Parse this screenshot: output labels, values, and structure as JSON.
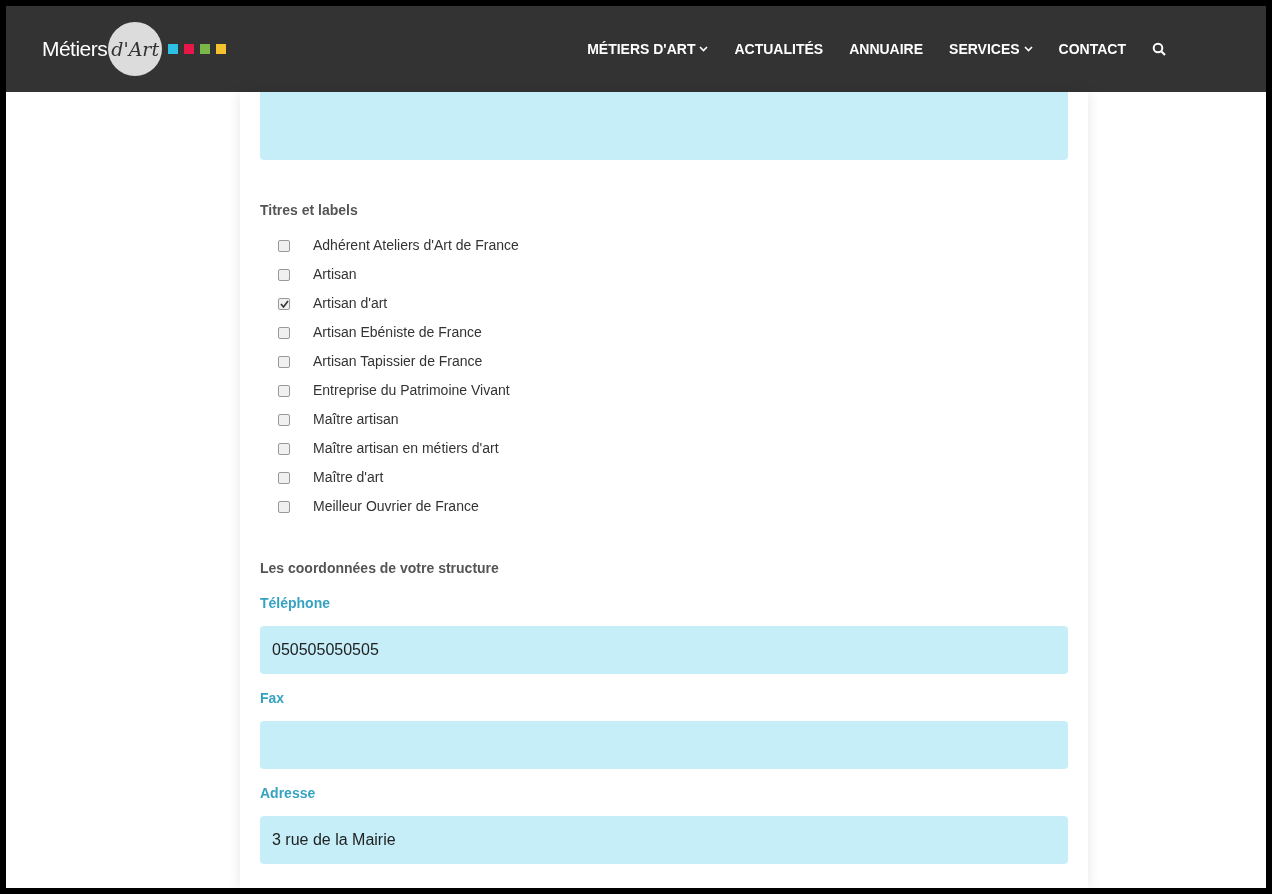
{
  "logo": {
    "word": "Métiers",
    "script": "d'Art"
  },
  "nav": [
    {
      "label": "MÉTIERS D'ART",
      "dropdown": true
    },
    {
      "label": "ACTUALITÉS",
      "dropdown": false
    },
    {
      "label": "ANNUAIRE",
      "dropdown": false
    },
    {
      "label": "SERVICES",
      "dropdown": true
    },
    {
      "label": "CONTACT",
      "dropdown": false
    }
  ],
  "titles": {
    "heading": "Titres et labels",
    "options": [
      {
        "label": "Adhérent Ateliers d'Art de France",
        "checked": false
      },
      {
        "label": "Artisan",
        "checked": false
      },
      {
        "label": "Artisan d'art",
        "checked": true
      },
      {
        "label": "Artisan Ebéniste de France",
        "checked": false
      },
      {
        "label": "Artisan Tapissier de France",
        "checked": false
      },
      {
        "label": "Entreprise du Patrimoine Vivant",
        "checked": false
      },
      {
        "label": "Maître artisan",
        "checked": false
      },
      {
        "label": "Maître artisan en métiers d'art",
        "checked": false
      },
      {
        "label": "Maître d'art",
        "checked": false
      },
      {
        "label": "Meilleur Ouvrier de France",
        "checked": false
      }
    ]
  },
  "contact": {
    "heading": "Les coordonnées de votre structure",
    "fields": [
      {
        "label": "Téléphone",
        "value": "050505050505"
      },
      {
        "label": "Fax"
      },
      {
        "label": "Adresse",
        "value": "3 rue de la Mairie"
      }
    ]
  }
}
